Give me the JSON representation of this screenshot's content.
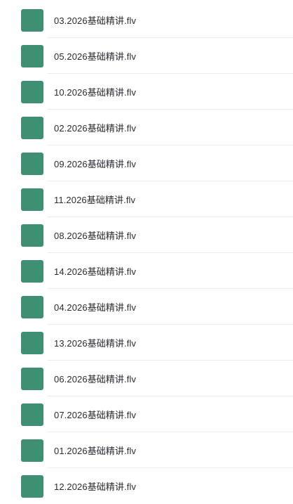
{
  "files": [
    {
      "name": "03.2026基础精讲.flv",
      "thumb": "chalkboard-teacher"
    },
    {
      "name": "05.2026基础精讲.flv",
      "thumb": "chalkboard-teacher"
    },
    {
      "name": "10.2026基础精讲.flv",
      "thumb": "whiteboard-diagram"
    },
    {
      "name": "02.2026基础精讲.flv",
      "thumb": "chalkboard-slide"
    },
    {
      "name": "09.2026基础精讲.flv",
      "thumb": "chalkboard-teacher"
    },
    {
      "name": "11.2026基础精讲.flv",
      "thumb": "chalkboard-teacher"
    },
    {
      "name": "08.2026基础精讲.flv",
      "thumb": "chalkboard-teacher"
    },
    {
      "name": "14.2026基础精讲.flv",
      "thumb": "teacher-closeup"
    },
    {
      "name": "04.2026基础精讲.flv",
      "thumb": "chalkboard-slide"
    },
    {
      "name": "13.2026基础精讲.flv",
      "thumb": "chalkboard-teacher"
    },
    {
      "name": "06.2026基础精讲.flv",
      "thumb": "chalkboard-slide"
    },
    {
      "name": "07.2026基础精讲.flv",
      "thumb": "chalkboard-teacher"
    },
    {
      "name": "01.2026基础精讲.flv",
      "thumb": "chalkboard-slide"
    },
    {
      "name": "12.2026基础精讲.flv",
      "thumb": "teacher-closeup"
    }
  ]
}
